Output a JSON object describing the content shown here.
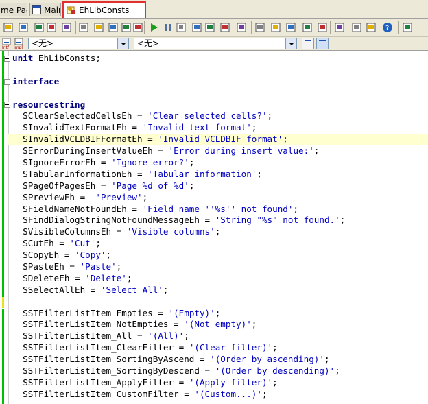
{
  "tabs": [
    {
      "label": "me Page",
      "icon": "none"
    },
    {
      "label": "Main",
      "icon": "form-icon"
    },
    {
      "label": "EhLibConsts",
      "icon": "unit-icon",
      "active": true
    }
  ],
  "combos": {
    "class_value": "<无>",
    "method_value": "<无>"
  },
  "toolbar_icons": [
    "new-items-icon",
    "open-project-icon",
    "save-icon",
    "save-all-icon",
    "add-file-icon",
    "remove-file-icon",
    "open-folder-icon",
    "unit-list-icon",
    "form-list-icon",
    "toggle-form-unit-icon",
    "run-icon",
    "pause-icon",
    "reset-icon",
    "trace-into-icon",
    "step-over-icon",
    "run-to-cursor-icon",
    "stack-icon",
    "debug-icon",
    "component-icon",
    "palette-icon",
    "database-icon",
    "package-icon",
    "new-form-icon",
    "module-icon",
    "options-icon",
    "help-icon",
    "tools-icon"
  ],
  "code_lines": [
    {
      "indent": "",
      "kw": "unit",
      "rest": " EhLibConsts;"
    },
    {
      "indent": "",
      "kw": "",
      "rest": ""
    },
    {
      "indent": "",
      "kw": "interface",
      "rest": ""
    },
    {
      "indent": "",
      "kw": "",
      "rest": ""
    },
    {
      "indent": "",
      "kw": "resourcestring",
      "rest": ""
    },
    {
      "indent": "  ",
      "id": "SClearSelectedCellsEh = ",
      "str": "'Clear selected cells?'",
      "tail": ";"
    },
    {
      "indent": "  ",
      "id": "SInvalidTextFormatEh = ",
      "str": "'Invalid text format'",
      "tail": ";"
    },
    {
      "indent": "  ",
      "id": "SInvalidVCLDBIFFormatEh = ",
      "str": "'Invalid VCLDBIF format'",
      "tail": ";",
      "highlight": true
    },
    {
      "indent": "  ",
      "id": "SErrorDuringInsertValueEh = ",
      "str": "'Error during insert value:'",
      "tail": ";"
    },
    {
      "indent": "  ",
      "id": "SIgnoreErrorEh = ",
      "str": "'Ignore error?'",
      "tail": ";"
    },
    {
      "indent": "  ",
      "id": "STabularInformationEh = ",
      "str": "'Tabular information'",
      "tail": ";"
    },
    {
      "indent": "  ",
      "id": "SPageOfPagesEh = ",
      "str": "'Page %d of %d'",
      "tail": ";"
    },
    {
      "indent": "  ",
      "id": "SPreviewEh =  ",
      "str": "'Preview'",
      "tail": ";"
    },
    {
      "indent": "  ",
      "id": "SFieldNameNotFoundEh = ",
      "str": "'Field name ''%s'' not found'",
      "tail": ";"
    },
    {
      "indent": "  ",
      "id": "SFindDialogStringNotFoundMessageEh = ",
      "str": "'String \"%s\" not found.'",
      "tail": ";"
    },
    {
      "indent": "  ",
      "id": "SVisibleColumnsEh = ",
      "str": "'Visible columns'",
      "tail": ";"
    },
    {
      "indent": "  ",
      "id": "SCutEh = ",
      "str": "'Cut'",
      "tail": ";"
    },
    {
      "indent": "  ",
      "id": "SCopyEh = ",
      "str": "'Copy'",
      "tail": ";"
    },
    {
      "indent": "  ",
      "id": "SPasteEh = ",
      "str": "'Paste'",
      "tail": ";"
    },
    {
      "indent": "  ",
      "id": "SDeleteEh = ",
      "str": "'Delete'",
      "tail": ";"
    },
    {
      "indent": "  ",
      "id": "SSelectAllEh = ",
      "str": "'Select All'",
      "tail": ";"
    },
    {
      "indent": "",
      "kw": "",
      "rest": ""
    },
    {
      "indent": "  ",
      "id": "SSTFilterListItem_Empties = ",
      "str": "'(Empty)'",
      "tail": ";"
    },
    {
      "indent": "  ",
      "id": "SSTFilterListItem_NotEmpties = ",
      "str": "'(Not empty)'",
      "tail": ";"
    },
    {
      "indent": "  ",
      "id": "SSTFilterListItem_All = ",
      "str": "'(All)'",
      "tail": ";"
    },
    {
      "indent": "  ",
      "id": "SSTFilterListItem_ClearFilter = ",
      "str": "'(Clear filter)'",
      "tail": ";"
    },
    {
      "indent": "  ",
      "id": "SSTFilterListItem_SortingByAscend = ",
      "str": "'(Order by ascending)'",
      "tail": ";"
    },
    {
      "indent": "  ",
      "id": "SSTFilterListItem_SortingByDescend = ",
      "str": "'(Order by descending)'",
      "tail": ";"
    },
    {
      "indent": "  ",
      "id": "SSTFilterListItem_ApplyFilter = ",
      "str": "'(Apply filter)'",
      "tail": ";"
    },
    {
      "indent": "  ",
      "id": "SSTFilterListItem_CustomFilter = ",
      "str": "'(Custom...)'",
      "tail": ";"
    }
  ],
  "colors": {
    "keyword": "#000080",
    "string": "#0000c0",
    "changed_marker": "#00c000",
    "unsaved_marker": "#e8e020",
    "active_tab_outline": "#e23030"
  }
}
